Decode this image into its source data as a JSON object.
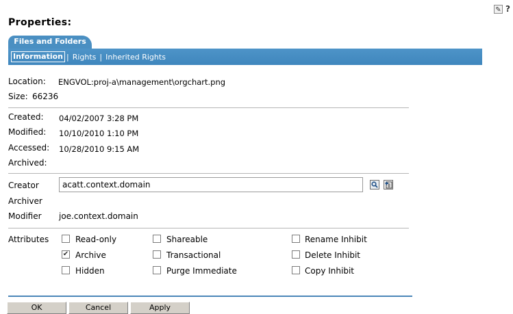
{
  "header": {
    "title": "Properties:",
    "tab": "Files and Folders",
    "edit_icon_glyph": "✎",
    "help_icon_glyph": "?"
  },
  "subnav": {
    "items": [
      "Information",
      "Rights",
      "Inherited Rights"
    ],
    "separator": "|"
  },
  "info": {
    "location_label": "Location:",
    "location_value": "ENGVOL:proj-a\\management\\orgchart.png",
    "size_label": "Size:",
    "size_value": "66236",
    "created_label": "Created:",
    "created_value": "04/02/2007  3:28 PM",
    "modified_label": "Modified:",
    "modified_value": "10/10/2010  1:10 PM",
    "accessed_label": "Accessed:",
    "accessed_value": "10/28/2010  9:15 AM",
    "archived_label": "Archived:",
    "archived_value": ""
  },
  "owners": {
    "creator_label": "Creator",
    "creator_value": "acatt.context.domain",
    "archiver_label": "Archiver",
    "archiver_value": "",
    "modifier_label": "Modifier",
    "modifier_value": "joe.context.domain"
  },
  "attributes": {
    "label": "Attributes",
    "items": [
      {
        "label": "Read-only",
        "checked": false
      },
      {
        "label": "Archive",
        "checked": true
      },
      {
        "label": "Hidden",
        "checked": false
      },
      {
        "label": "Shareable",
        "checked": false
      },
      {
        "label": "Transactional",
        "checked": false
      },
      {
        "label": "Purge Immediate",
        "checked": false
      },
      {
        "label": "Rename Inhibit",
        "checked": false
      },
      {
        "label": "Delete Inhibit",
        "checked": false
      },
      {
        "label": "Copy Inhibit",
        "checked": false
      }
    ],
    "check_glyph": "✔"
  },
  "buttons": {
    "ok": "OK",
    "cancel": "Cancel",
    "apply": "Apply"
  }
}
